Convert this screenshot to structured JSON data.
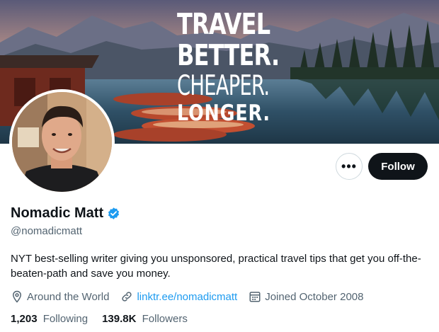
{
  "banner": {
    "line1": "TRAVEL",
    "line2": "BETTER.",
    "line3": "CHEAPER.",
    "line4": "LONGER."
  },
  "profile": {
    "name": "Nomadic Matt",
    "handle": "@nomadicmatt",
    "bio": "NYT best-selling writer giving you unsponsored, practical travel tips that get you off-the-beaten-path and save you money.",
    "location": "Around the World",
    "website": "linktr.ee/nomadicmatt",
    "joined": "Joined October 2008",
    "verified_icon": "verified-badge-icon"
  },
  "actions": {
    "more_label": "•••",
    "follow_label": "Follow"
  },
  "stats": {
    "following_count": "1,203",
    "following_label": "Following",
    "followers_count": "139.8K",
    "followers_label": "Followers"
  },
  "colors": {
    "accent": "#1d9bf0",
    "text": "#0f1419",
    "muted": "#536471",
    "follow_bg": "#0f1419"
  }
}
